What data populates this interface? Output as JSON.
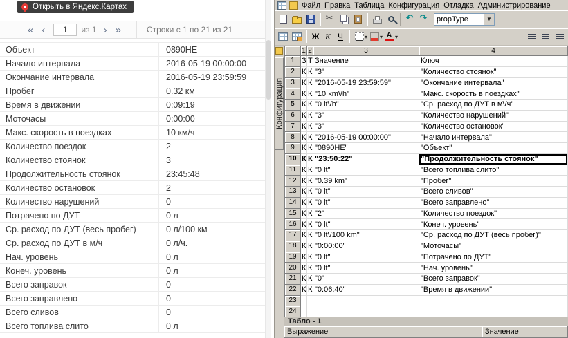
{
  "left_panel": {
    "map_tooltip": "Открыть в Яндекс.Картах",
    "pagination": {
      "first": "«",
      "prev": "‹",
      "page": "1",
      "of": "из 1",
      "next": "›",
      "last": "»",
      "rows_info": "Строки с 1 по 21 из 21"
    },
    "report_rows": [
      {
        "label": "Объект",
        "value": "0890НЕ"
      },
      {
        "label": "Начало интервала",
        "value": "2016-05-19 00:00:00"
      },
      {
        "label": "Окончание интервала",
        "value": "2016-05-19 23:59:59"
      },
      {
        "label": "Пробег",
        "value": "0.32 км"
      },
      {
        "label": "Время в движении",
        "value": "0:09:19"
      },
      {
        "label": "Моточасы",
        "value": "0:00:00"
      },
      {
        "label": "Макс. скорость в поездках",
        "value": "10 км/ч"
      },
      {
        "label": "Количество поездок",
        "value": "2"
      },
      {
        "label": "Количество стоянок",
        "value": "3"
      },
      {
        "label": "Продолжительность стоянок",
        "value": "23:45:48"
      },
      {
        "label": "Количество остановок",
        "value": "2"
      },
      {
        "label": "Количество нарушений",
        "value": "0"
      },
      {
        "label": "Потрачено по ДУТ",
        "value": "0 л"
      },
      {
        "label": "Ср. расход по ДУТ (весь пробег)",
        "value": "0 л/100 км"
      },
      {
        "label": "Ср. расход по ДУТ в м/ч",
        "value": "0 л/ч."
      },
      {
        "label": "Нач. уровень",
        "value": "0 л"
      },
      {
        "label": "Конеч. уровень",
        "value": "0 л"
      },
      {
        "label": "Всего заправок",
        "value": "0"
      },
      {
        "label": "Всего заправлено",
        "value": "0"
      },
      {
        "label": "Всего сливов",
        "value": "0"
      },
      {
        "label": "Всего топлива слито",
        "value": "0 л"
      }
    ]
  },
  "right_panel": {
    "menu": [
      "Файл",
      "Правка",
      "Таблица",
      "Конфигурация",
      "Отладка",
      "Администрирование"
    ],
    "toolbar1": {
      "groups": [
        [
          "new-document",
          "open-folder",
          "save"
        ],
        [
          "cut",
          "copy",
          "paste"
        ],
        [
          "print",
          "search"
        ],
        [
          "undo",
          "redo"
        ]
      ],
      "combo_value": "propType"
    },
    "toolbar2": {
      "left_groups": [
        [
          "table-grid",
          "table-edit"
        ]
      ],
      "format_buttons": [
        {
          "name": "bold",
          "label": "Ж"
        },
        {
          "name": "italic",
          "label": "К"
        },
        {
          "name": "underline",
          "label": "Ч"
        }
      ],
      "color_groups": [
        [
          "borders",
          "fill-color",
          "font-color"
        ]
      ],
      "align_group": [
        "align-left",
        "align-center",
        "align-right"
      ]
    },
    "side_tab": "Конфигурация",
    "grid": {
      "columns": [
        "1",
        "2",
        "3",
        "4"
      ],
      "selected_row": "10",
      "rows": [
        {
          "n": "1",
          "c1": "З",
          "c2": "Т",
          "c3": "Значение",
          "c4": "Ключ"
        },
        {
          "n": "2",
          "c1": "К",
          "c2": "К",
          "c3": "\"3\"",
          "c4": "\"Количество стоянок\""
        },
        {
          "n": "3",
          "c1": "К",
          "c2": "К",
          "c3": "\"2016-05-19 23:59:59\"",
          "c4": "\"Окончание интервала\""
        },
        {
          "n": "4",
          "c1": "К",
          "c2": "К",
          "c3": "\"10 km\\/h\"",
          "c4": "\"Макс. скорость в поездках\""
        },
        {
          "n": "5",
          "c1": "К",
          "c2": "К",
          "c3": "\"0 lt\\/h\"",
          "c4": "\"Ср. расход по ДУТ в м\\/ч\""
        },
        {
          "n": "6",
          "c1": "К",
          "c2": "К",
          "c3": "\"3\"",
          "c4": "\"Количество нарушений\""
        },
        {
          "n": "7",
          "c1": "К",
          "c2": "К",
          "c3": "\"3\"",
          "c4": "\"Количество остановок\""
        },
        {
          "n": "8",
          "c1": "К",
          "c2": "К",
          "c3": "\"2016-05-19 00:00:00\"",
          "c4": "\"Начало интервала\""
        },
        {
          "n": "9",
          "c1": "К",
          "c2": "К",
          "c3": "\"0890HE\"",
          "c4": "\"Объект\""
        },
        {
          "n": "10",
          "c1": "К",
          "c2": "К",
          "c3": "\"23:50:22\"",
          "c4": "\"Продолжительность стоянок\""
        },
        {
          "n": "11",
          "c1": "К",
          "c2": "К",
          "c3": "\"0 lt\"",
          "c4": "\"Всего топлива слито\""
        },
        {
          "n": "12",
          "c1": "К",
          "c2": "К",
          "c3": "\"0.39 km\"",
          "c4": "\"Пробег\""
        },
        {
          "n": "13",
          "c1": "К",
          "c2": "К",
          "c3": "\"0 lt\"",
          "c4": "\"Всего сливов\""
        },
        {
          "n": "14",
          "c1": "К",
          "c2": "К",
          "c3": "\"0 lt\"",
          "c4": "\"Всего заправлено\""
        },
        {
          "n": "15",
          "c1": "К",
          "c2": "К",
          "c3": "\"2\"",
          "c4": "\"Количество поездок\""
        },
        {
          "n": "16",
          "c1": "К",
          "c2": "К",
          "c3": "\"0 lt\"",
          "c4": "\"Конеч. уровень\""
        },
        {
          "n": "17",
          "c1": "К",
          "c2": "К",
          "c3": "\"0 lt\\/100 km\"",
          "c4": "\"Ср. расход по ДУТ (весь пробег)\""
        },
        {
          "n": "18",
          "c1": "К",
          "c2": "К",
          "c3": "\"0:00:00\"",
          "c4": "\"Моточасы\""
        },
        {
          "n": "19",
          "c1": "К",
          "c2": "К",
          "c3": "\"0 lt\"",
          "c4": "\"Потрачено по ДУТ\""
        },
        {
          "n": "20",
          "c1": "К",
          "c2": "К",
          "c3": "\"0 lt\"",
          "c4": "\"Нач. уровень\""
        },
        {
          "n": "21",
          "c1": "К",
          "c2": "К",
          "c3": "\"0\"",
          "c4": "\"Всего заправок\""
        },
        {
          "n": "22",
          "c1": "К",
          "c2": "К",
          "c3": "\"0:06:40\"",
          "c4": "\"Время в движении\""
        },
        {
          "n": "23",
          "c1": "",
          "c2": "",
          "c3": "",
          "c4": ""
        },
        {
          "n": "24",
          "c1": "",
          "c2": "",
          "c3": "",
          "c4": ""
        }
      ]
    },
    "tablo": {
      "title": "Табло - 1",
      "columns": [
        "Выражение",
        "Значение"
      ]
    }
  },
  "colors": {
    "accent_red": "#e53935",
    "toolbar_bg": "#d4d0c8",
    "tooltip_bg": "#3d3d3d"
  }
}
